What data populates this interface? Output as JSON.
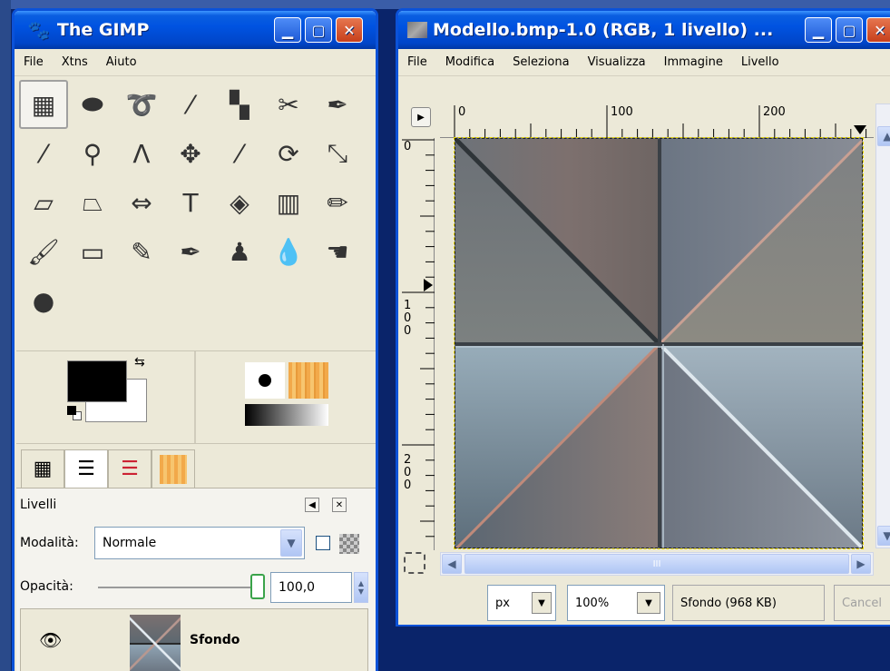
{
  "toolbox": {
    "title": "The GIMP",
    "menu": [
      "File",
      "Xtns",
      "Aiuto"
    ],
    "tools": [
      {
        "name": "rect-select-icon",
        "glyph": "▦"
      },
      {
        "name": "ellipse-select-icon",
        "glyph": "⬬"
      },
      {
        "name": "free-select-icon",
        "glyph": "➰"
      },
      {
        "name": "fuzzy-select-icon",
        "glyph": "⁄"
      },
      {
        "name": "select-by-color-icon",
        "glyph": "▚"
      },
      {
        "name": "scissors-icon",
        "glyph": "✂"
      },
      {
        "name": "paths-icon",
        "glyph": "✒"
      },
      {
        "name": "color-picker-icon",
        "glyph": "⁄"
      },
      {
        "name": "zoom-icon",
        "glyph": "⚲"
      },
      {
        "name": "measure-icon",
        "glyph": "Λ"
      },
      {
        "name": "move-icon",
        "glyph": "✥"
      },
      {
        "name": "crop-icon",
        "glyph": "⁄"
      },
      {
        "name": "rotate-icon",
        "glyph": "⟳"
      },
      {
        "name": "scale-icon",
        "glyph": "⤡"
      },
      {
        "name": "shear-icon",
        "glyph": "▱"
      },
      {
        "name": "perspective-icon",
        "glyph": "⏢"
      },
      {
        "name": "flip-icon",
        "glyph": "⇔"
      },
      {
        "name": "text-icon",
        "glyph": "T"
      },
      {
        "name": "bucket-fill-icon",
        "glyph": "◈"
      },
      {
        "name": "blend-icon",
        "glyph": "▥"
      },
      {
        "name": "pencil-icon",
        "glyph": "✏"
      },
      {
        "name": "paintbrush-icon",
        "glyph": "🖌"
      },
      {
        "name": "eraser-icon",
        "glyph": "▭"
      },
      {
        "name": "airbrush-icon",
        "glyph": "✎"
      },
      {
        "name": "ink-icon",
        "glyph": "✒"
      },
      {
        "name": "clone-icon",
        "glyph": "♟"
      },
      {
        "name": "blur-icon",
        "glyph": "💧"
      },
      {
        "name": "smudge-icon",
        "glyph": "☚"
      },
      {
        "name": "dodge-burn-icon",
        "glyph": "●"
      }
    ],
    "layers": {
      "title": "Livelli",
      "mode_label": "Modalità:",
      "mode_value": "Normale",
      "opacity_label": "Opacità:",
      "opacity_value": "100,0",
      "layer_name": "Sfondo"
    }
  },
  "image_window": {
    "title": "Modello.bmp-1.0 (RGB, 1 livello) ...",
    "menu": [
      "File",
      "Modifica",
      "Seleziona",
      "Visualizza",
      "Immagine",
      "Livello"
    ],
    "ruler_h_labels": [
      "0",
      "100",
      "200"
    ],
    "ruler_v_labels": [
      "0",
      "100",
      "200"
    ],
    "unit": "px",
    "zoom": "100%",
    "status_text": "Sfondo (968 KB)",
    "cancel_label": "Cancel",
    "scroll_grip": "III"
  }
}
